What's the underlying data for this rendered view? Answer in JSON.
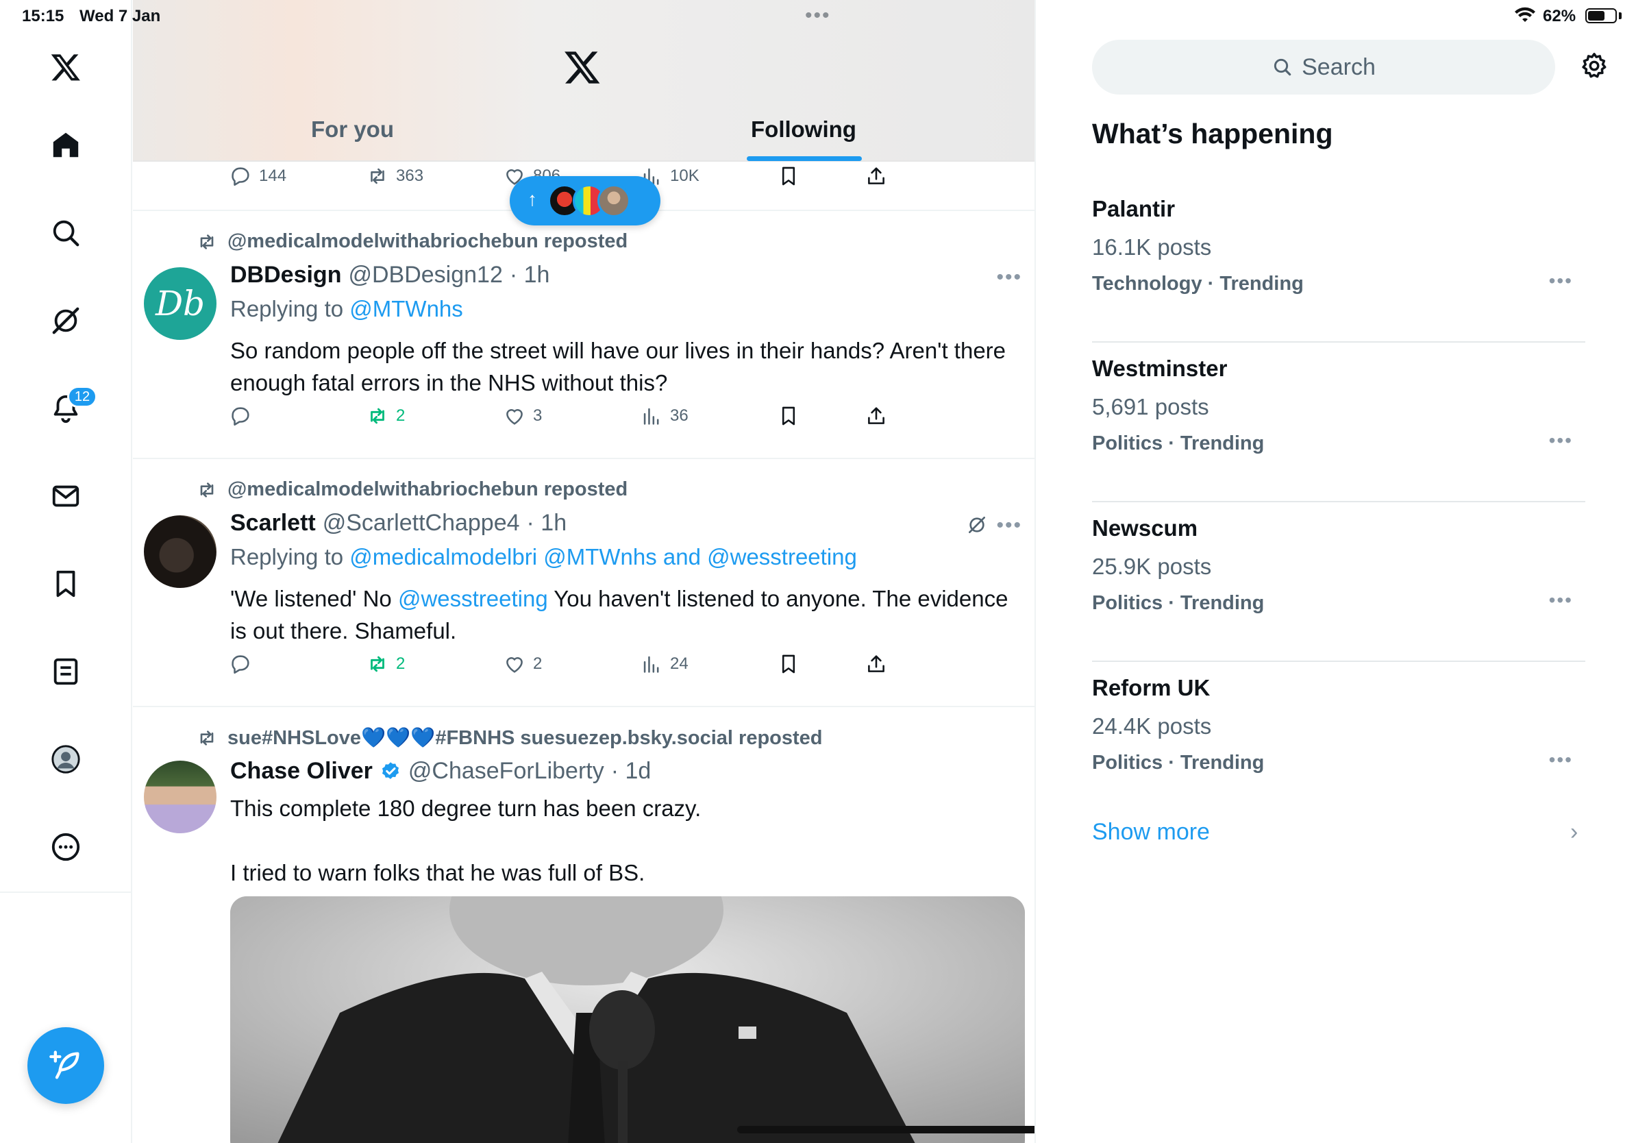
{
  "status_bar": {
    "time": "15:15",
    "date": "Wed 7 Jan",
    "battery": "62%",
    "battery_level": 0.62
  },
  "nav": {
    "notifications_badge": "12"
  },
  "header": {
    "tabs": [
      {
        "label": "For you"
      },
      {
        "label": "Following"
      }
    ],
    "active_tab": "Following"
  },
  "top_post_actions": {
    "replies": "144",
    "reposts": "363",
    "likes": "806",
    "views": "10K"
  },
  "posts": [
    {
      "repost_by": "@medicalmodelwithabriochebun reposted",
      "name": "DBDesign",
      "handle": "@DBDesign12",
      "time": "· 1h",
      "replying_prefix": "Replying to",
      "replying_to": "@MTWnhs",
      "text": "So random people off the street will have our lives in their hands?  Aren't there enough fatal errors in the NHS without this?",
      "replies": "",
      "reposts": "2",
      "likes": "3",
      "views": "36",
      "avatar_text": "Db"
    },
    {
      "repost_by": "@medicalmodelwithabriochebun reposted",
      "name": "Scarlett",
      "handle": "@ScarlettChappe4",
      "time": "· 1h",
      "replying_prefix": "Replying to",
      "replying_to": "@medicalmodelbri @MTWnhs and @wesstreeting",
      "text_pre": "'We listened' No ",
      "text_mention": "@wesstreeting",
      "text_post": " You haven't listened to anyone. The evidence is out there. Shameful.",
      "reposts": "2",
      "likes": "2",
      "views": "24"
    },
    {
      "repost_by": "sue#NHSLove💙💙💙#FBNHS suesuezep.bsky.social reposted",
      "name": "Chase Oliver",
      "handle": "@ChaseForLiberty",
      "time": "· 1d",
      "line1": "This complete 180 degree turn has been crazy.",
      "line2": "I tried to warn folks that he was full of BS."
    }
  ],
  "sidebar": {
    "search_placeholder": "Search",
    "title": "What’s happening",
    "trends": [
      {
        "name": "Palantir",
        "count": "16.1K posts",
        "category": "Technology · Trending"
      },
      {
        "name": "Westminster",
        "count": "5,691 posts",
        "category": "Politics · Trending"
      },
      {
        "name": "Newscum",
        "count": "25.9K posts",
        "category": "Politics · Trending"
      },
      {
        "name": "Reform UK",
        "count": "24.4K posts",
        "category": "Politics · Trending"
      }
    ],
    "show_more": "Show more"
  },
  "colors": {
    "accent": "#1d9bf0",
    "repost_green": "#00ba7c",
    "muted": "#536471"
  }
}
